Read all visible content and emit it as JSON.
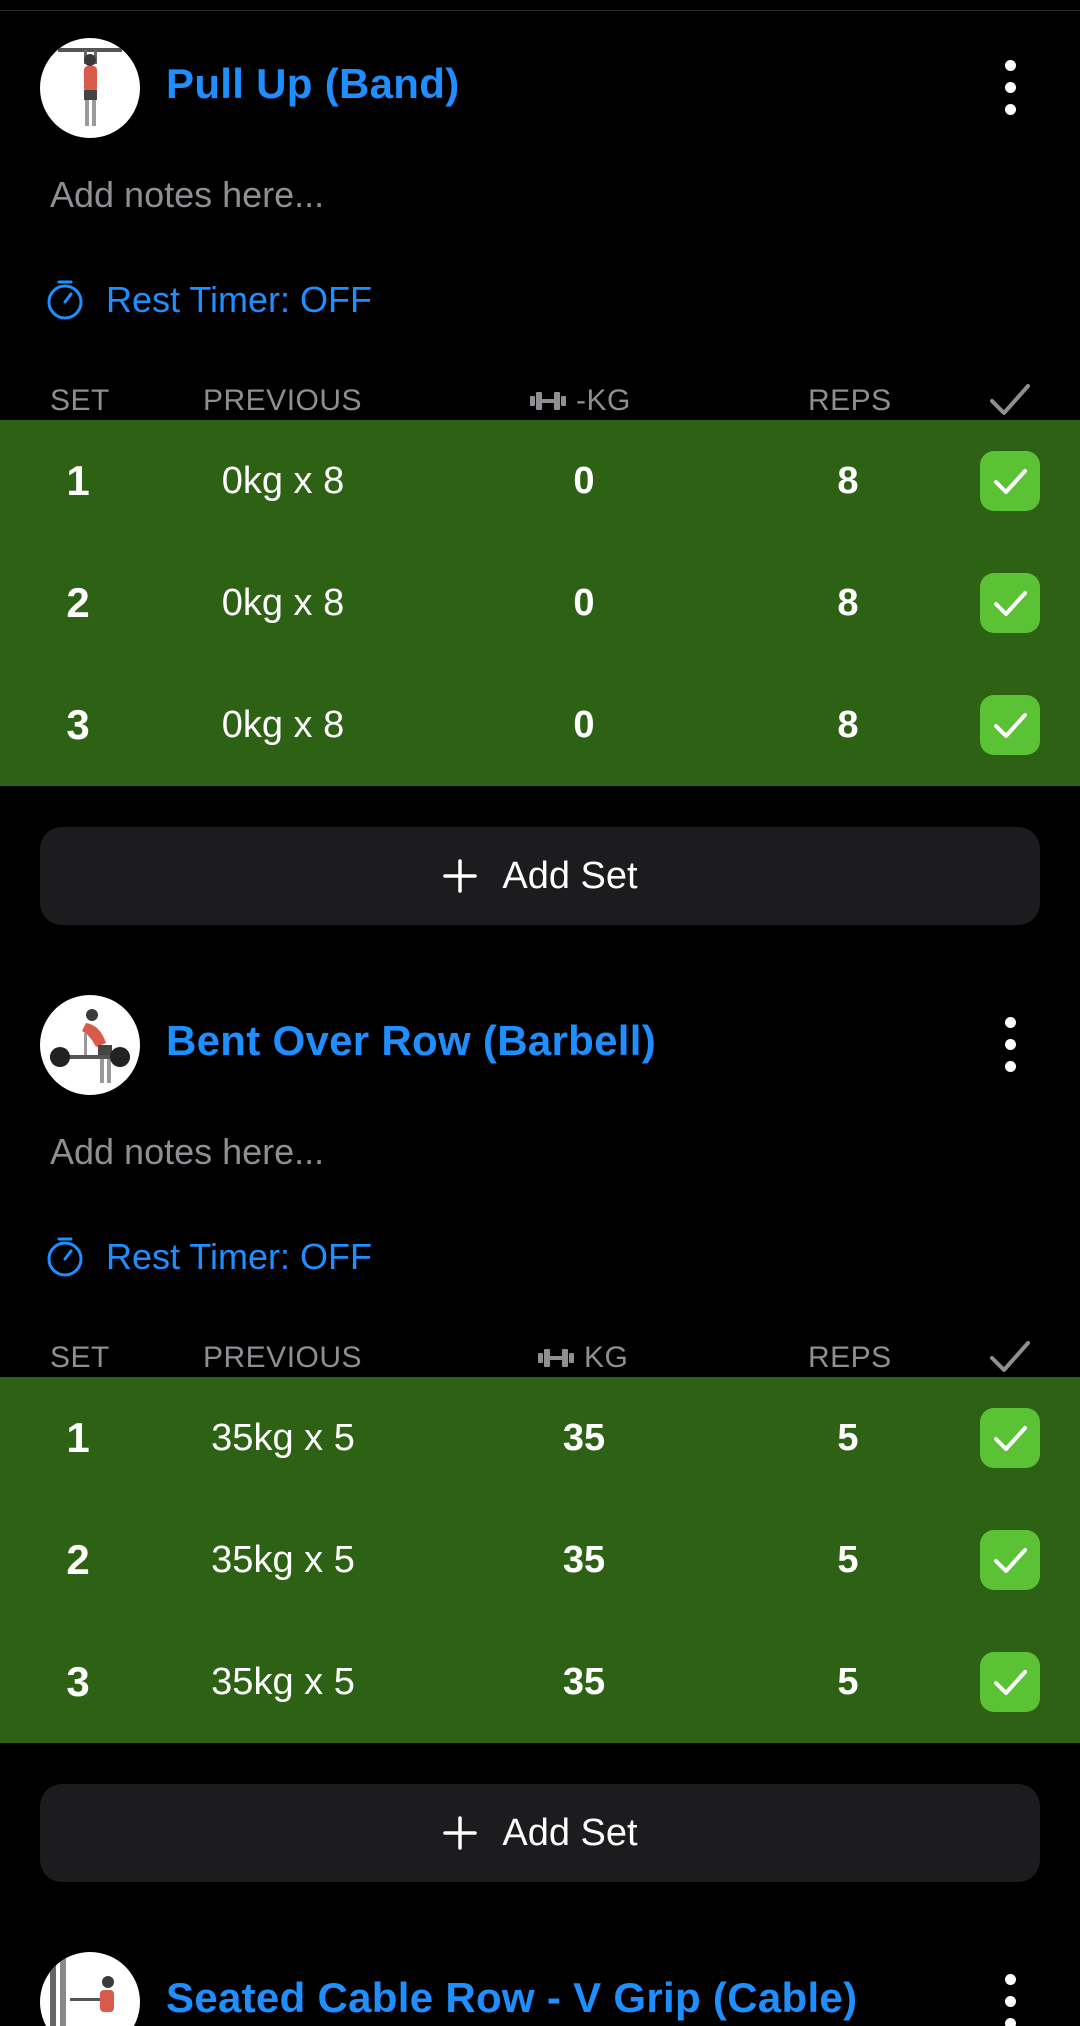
{
  "colors": {
    "accent": "#1f8fff",
    "completed_row": "#2d6114",
    "checkbox": "#5bc236",
    "button_bg": "#1c1c1e",
    "muted_text": "#8e8e93"
  },
  "exercises": [
    {
      "title": "Pull Up (Band)",
      "thumbnail_icon": "pull-up-figure-icon",
      "notes_placeholder": "Add notes here...",
      "rest_timer": "Rest Timer: OFF",
      "columns": {
        "set": "SET",
        "previous": "PREVIOUS",
        "weight": "-KG",
        "reps": "REPS"
      },
      "sets": [
        {
          "set": "1",
          "previous": "0kg x 8",
          "weight": "0",
          "reps": "8",
          "completed": true
        },
        {
          "set": "2",
          "previous": "0kg x 8",
          "weight": "0",
          "reps": "8",
          "completed": true
        },
        {
          "set": "3",
          "previous": "0kg x 8",
          "weight": "0",
          "reps": "8",
          "completed": true
        }
      ],
      "add_set_label": "Add Set"
    },
    {
      "title": "Bent Over Row (Barbell)",
      "thumbnail_icon": "barbell-row-figure-icon",
      "notes_placeholder": "Add notes here...",
      "rest_timer": "Rest Timer: OFF",
      "columns": {
        "set": "SET",
        "previous": "PREVIOUS",
        "weight": "KG",
        "reps": "REPS"
      },
      "sets": [
        {
          "set": "1",
          "previous": "35kg x 5",
          "weight": "35",
          "reps": "5",
          "completed": true
        },
        {
          "set": "2",
          "previous": "35kg x 5",
          "weight": "35",
          "reps": "5",
          "completed": true
        },
        {
          "set": "3",
          "previous": "35kg x 5",
          "weight": "35",
          "reps": "5",
          "completed": true
        }
      ],
      "add_set_label": "Add Set"
    },
    {
      "title": "Seated Cable Row - V Grip (Cable)",
      "thumbnail_icon": "cable-row-figure-icon"
    }
  ]
}
